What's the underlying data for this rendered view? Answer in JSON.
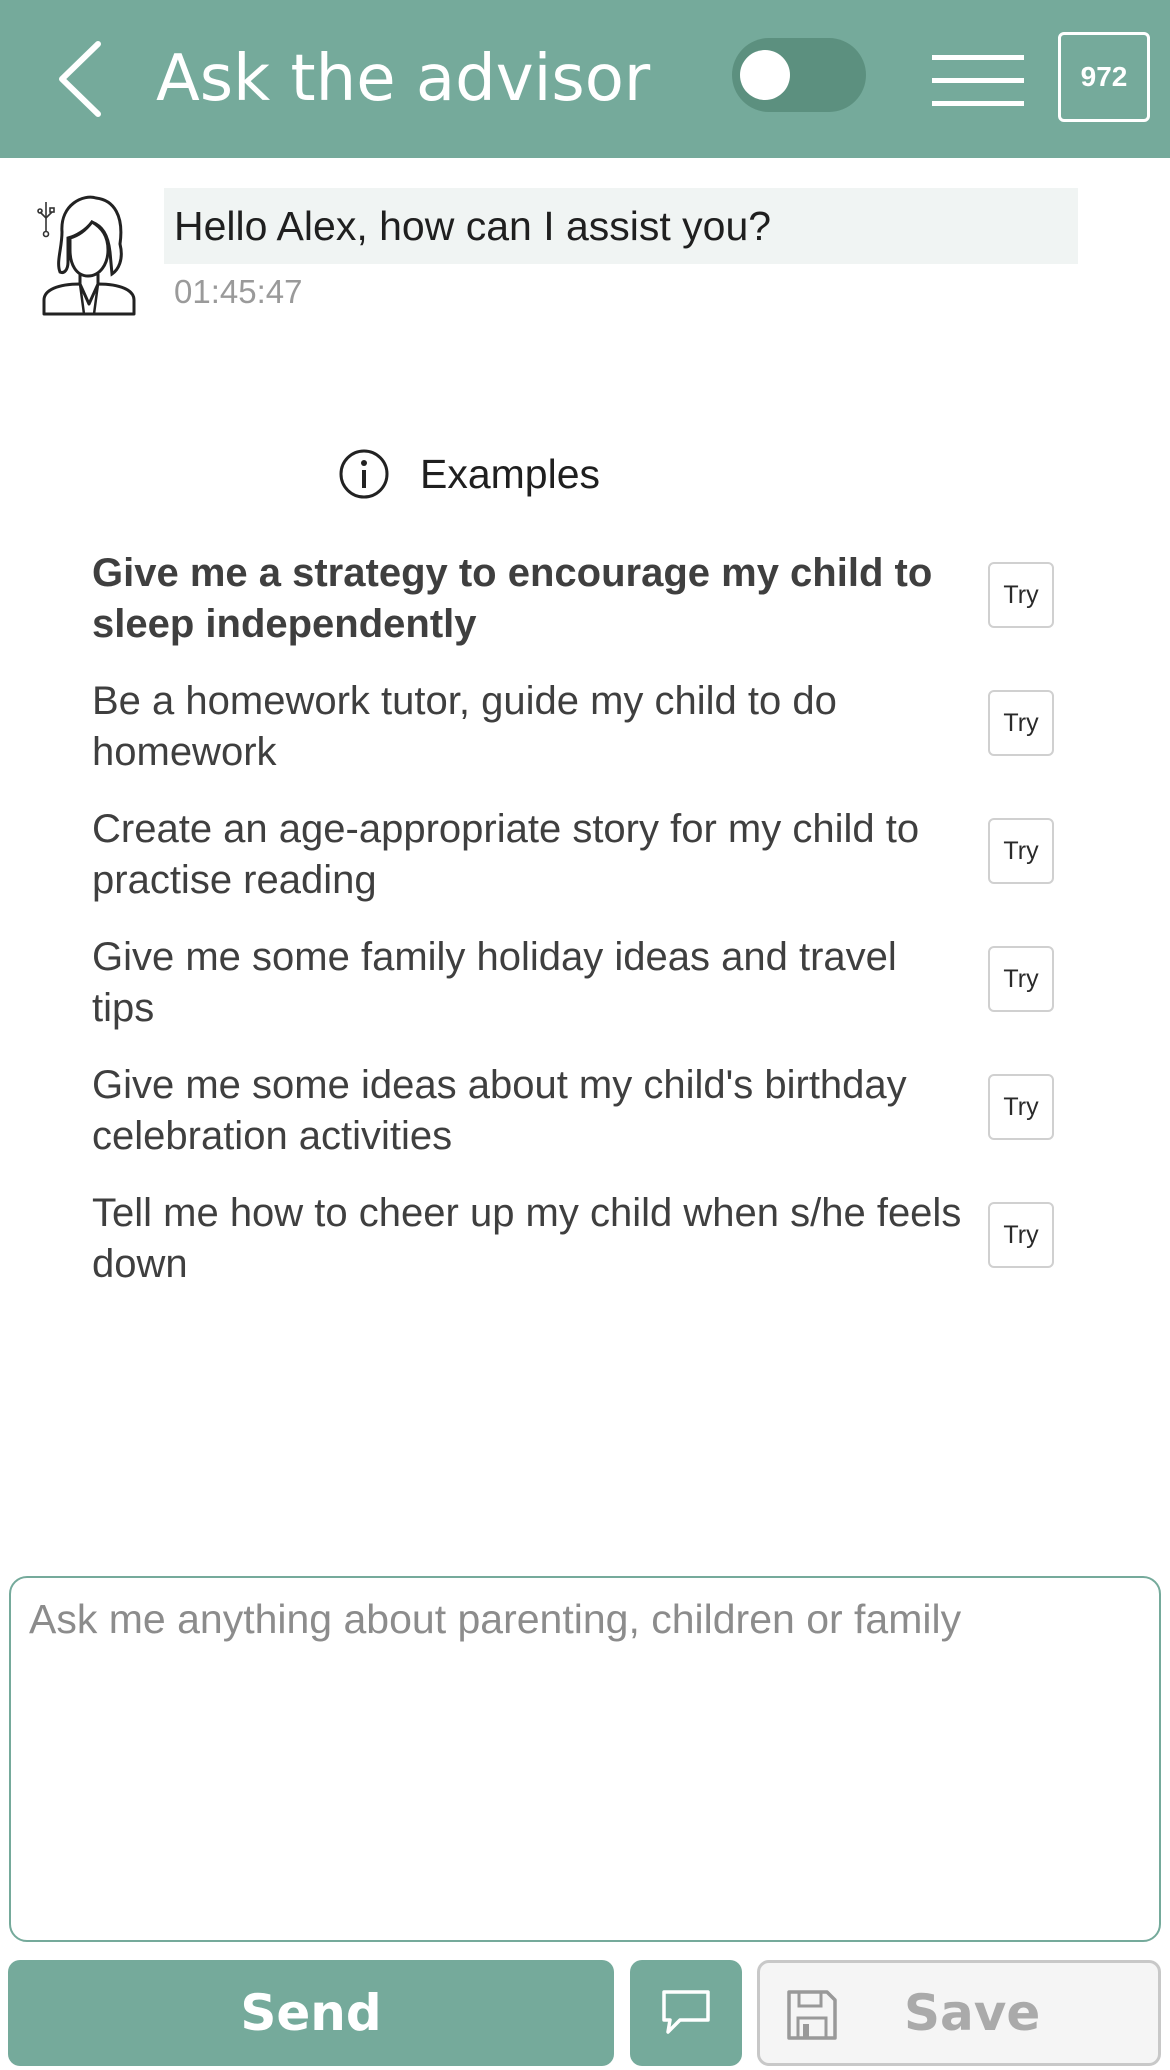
{
  "header": {
    "title": "Ask the advisor",
    "counter": "972",
    "toggle_state": "off"
  },
  "chat": {
    "messages": [
      {
        "sender": "advisor",
        "avatar_icon": "advisor-avatar-icon",
        "text": "Hello Alex, how can I assist you?",
        "time": "01:45:47"
      }
    ]
  },
  "examples": {
    "heading": "Examples",
    "try_label": "Try",
    "items": [
      {
        "text": "Give me a strategy to encourage my child to sleep independently",
        "highlighted": true
      },
      {
        "text": "Be a homework tutor, guide my child to do homework",
        "highlighted": false
      },
      {
        "text": "Create an age-appropriate story for my child to practise reading",
        "highlighted": false
      },
      {
        "text": "Give me some family holiday ideas and travel tips",
        "highlighted": false
      },
      {
        "text": "Give me some ideas about my child's birthday celebration activities",
        "highlighted": false
      },
      {
        "text": "Tell me how to cheer up my child when s/he feels down",
        "highlighted": false
      }
    ]
  },
  "input": {
    "value": "",
    "placeholder": "Ask me anything about parenting, children or family"
  },
  "actions": {
    "send_label": "Send",
    "save_label": "Save",
    "save_enabled": false
  },
  "colors": {
    "accent": "#75aa9b",
    "bubble": "#f0f4f3",
    "disabled": "#aaaaaa"
  }
}
